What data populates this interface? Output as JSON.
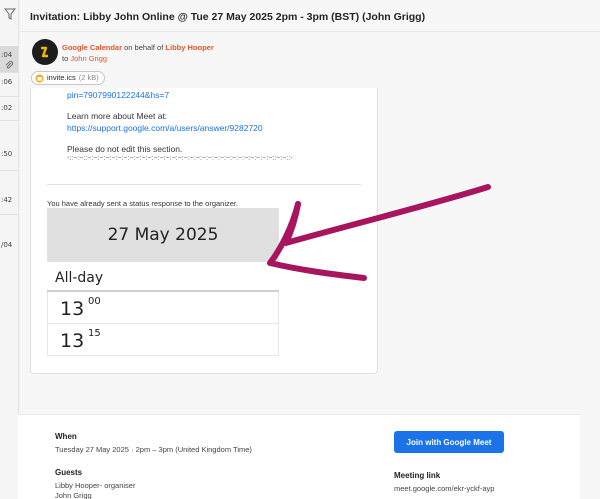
{
  "left_strip": {
    "times": [
      ":04",
      ":06",
      ":02",
      ":50",
      ":42",
      "/04"
    ]
  },
  "email": {
    "subject": "Invitation: Libby John Online @ Tue 27 May 2025 2pm - 3pm (BST) (John Grigg)",
    "sender_service": "Google Calendar",
    "on_behalf_text": "on behalf of",
    "on_behalf_name": "Libby Hooper",
    "to_prefix": "to",
    "to_name": "John Grigg",
    "attachment": {
      "name": "invite.ics",
      "size": "(2 kB)"
    }
  },
  "body": {
    "pin_fragment": "pin=7907990122244&hs=7",
    "learn_more": "Learn more about Meet at:",
    "support_link": "https://support.google.com/a/users/answer/9282720",
    "do_not_edit": "Please do not edit this section.",
    "separator": "-::~:~::~:~:~:~:~:~:~:~:~:~:~:~:~:~:~:~:~:~:~:~:~:~:~:~:~:~:~:~:~:~:~::~:~::-"
  },
  "status_note": "You have already sent a status response to the organizer.",
  "calendar": {
    "date": "27 May 2025",
    "all_day": "All-day",
    "slots": [
      {
        "hour": "13",
        "minute": "00"
      },
      {
        "hour": "13",
        "minute": "15"
      }
    ]
  },
  "details": {
    "when_label": "When",
    "when_value": "Tuesday 27 May 2025 · 2pm – 3pm (United Kingdom Time)",
    "guests_label": "Guests",
    "guest_1": "Libby Hooper",
    "guest_1_role": "- organiser",
    "guest_2": "John Grigg",
    "join_button": "Join with Google Meet",
    "meeting_link_label": "Meeting link",
    "meeting_link": "meet.google.com/ekr-yckf-ayp"
  },
  "colors": {
    "annotation_arrow": "#a8145e",
    "meet_button": "#1a73e8",
    "sender_accent": "#e0562c"
  }
}
